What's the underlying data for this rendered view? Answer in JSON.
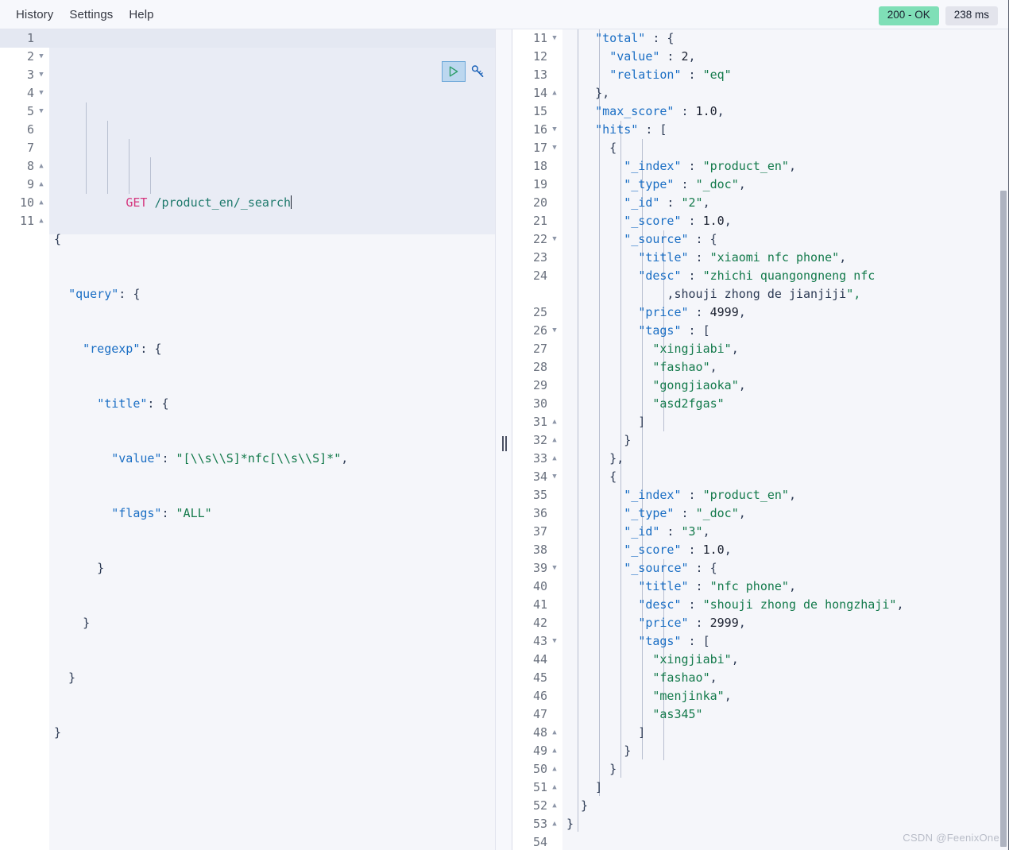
{
  "menu": {
    "items": [
      {
        "label": "History",
        "name": "menu-history"
      },
      {
        "label": "Settings",
        "name": "menu-settings"
      },
      {
        "label": "Help",
        "name": "menu-help"
      }
    ]
  },
  "status": {
    "response_status": "200 - OK",
    "response_time": "238 ms",
    "status_color": "#7fdfb7",
    "time_color": "#e3e4ec"
  },
  "actions": {
    "play_label": "send-request",
    "wrench_label": "request-options"
  },
  "request": {
    "method": "GET",
    "url": "/product_en/_search",
    "line_numbers": [
      "1",
      "2",
      "3",
      "4",
      "5",
      "6",
      "7",
      "8",
      "9",
      "10",
      "11"
    ],
    "folds": [
      "",
      "down",
      "down",
      "down",
      "down",
      "",
      "",
      "up",
      "up",
      "up",
      "up"
    ],
    "lines": [
      "GET /product_en/_search",
      "{",
      "  \"query\": {",
      "    \"regexp\": {",
      "      \"title\": {",
      "        \"value\": \"[\\\\s\\\\S]*nfc[\\\\s\\\\S]*\",",
      "        \"flags\": \"ALL\"",
      "      }",
      "    }",
      "  }",
      "}"
    ],
    "json_body": {
      "query": {
        "regexp": {
          "title": {
            "value": "[\\\\s\\\\S]*nfc[\\\\s\\\\S]*",
            "flags": "ALL"
          }
        }
      }
    }
  },
  "response": {
    "line_numbers": [
      "11",
      "12",
      "13",
      "14",
      "15",
      "16",
      "17",
      "18",
      "19",
      "20",
      "21",
      "22",
      "23",
      "24",
      "",
      "25",
      "26",
      "27",
      "28",
      "29",
      "30",
      "31",
      "32",
      "33",
      "34",
      "35",
      "36",
      "37",
      "38",
      "39",
      "40",
      "41",
      "42",
      "43",
      "44",
      "45",
      "46",
      "47",
      "48",
      "49",
      "50",
      "51",
      "52",
      "53",
      "54"
    ],
    "folds": [
      "down",
      "",
      "",
      "up",
      "",
      "down",
      "down",
      "",
      "",
      "",
      "",
      "down",
      "",
      "",
      "",
      "",
      "down",
      "",
      "",
      "",
      "",
      "up",
      "up",
      "up",
      "down",
      "",
      "",
      "",
      "",
      "down",
      "",
      "",
      "",
      "down",
      "",
      "",
      "",
      "",
      "up",
      "up",
      "up",
      "up",
      "up",
      "up",
      ""
    ],
    "lines": [
      "    \"total\" : {",
      "      \"value\" : 2,",
      "      \"relation\" : \"eq\"",
      "    },",
      "    \"max_score\" : 1.0,",
      "    \"hits\" : [",
      "      {",
      "        \"_index\" : \"product_en\",",
      "        \"_type\" : \"_doc\",",
      "        \"_id\" : \"2\",",
      "        \"_score\" : 1.0,",
      "        \"_source\" : {",
      "          \"title\" : \"xiaomi nfc phone\",",
      "          \"desc\" : \"zhichi quangongneng nfc",
      "              ,shouji zhong de jianjiji\",",
      "          \"price\" : 4999,",
      "          \"tags\" : [",
      "            \"xingjiabi\",",
      "            \"fashao\",",
      "            \"gongjiaoka\",",
      "            \"asd2fgas\"",
      "          ]",
      "        }",
      "      },",
      "      {",
      "        \"_index\" : \"product_en\",",
      "        \"_type\" : \"_doc\",",
      "        \"_id\" : \"3\",",
      "        \"_score\" : 1.0,",
      "        \"_source\" : {",
      "          \"title\" : \"nfc phone\",",
      "          \"desc\" : \"shouji zhong de hongzhaji\",",
      "          \"price\" : 2999,",
      "          \"tags\" : [",
      "            \"xingjiabi\",",
      "            \"fashao\",",
      "            \"menjinka\",",
      "            \"as345\"",
      "          ]",
      "        }",
      "      }",
      "    ]",
      "  }",
      "}",
      ""
    ],
    "parsed": {
      "hits": {
        "total": {
          "value": 2,
          "relation": "eq"
        },
        "max_score": 1.0,
        "hits": [
          {
            "_index": "product_en",
            "_type": "_doc",
            "_id": "2",
            "_score": 1.0,
            "_source": {
              "title": "xiaomi nfc phone",
              "desc": "zhichi quangongneng nfc ,shouji zhong de jianjiji",
              "price": 4999,
              "tags": [
                "xingjiabi",
                "fashao",
                "gongjiaoka",
                "asd2fgas"
              ]
            }
          },
          {
            "_index": "product_en",
            "_type": "_doc",
            "_id": "3",
            "_score": 1.0,
            "_source": {
              "title": "nfc phone",
              "desc": "shouji zhong de hongzhaji",
              "price": 2999,
              "tags": [
                "xingjiabi",
                "fashao",
                "menjinka",
                "as345"
              ]
            }
          }
        ]
      }
    }
  },
  "watermark": "CSDN @FeenixOne"
}
